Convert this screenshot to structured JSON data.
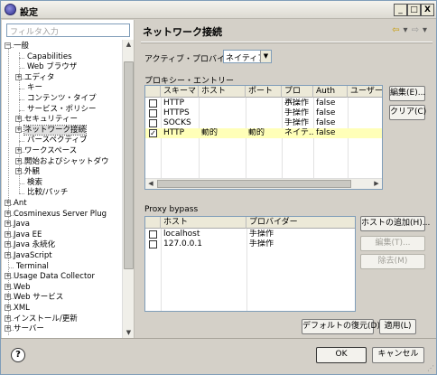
{
  "window": {
    "title": "設定",
    "controls": [
      "_",
      "□",
      "X"
    ]
  },
  "left": {
    "filter_placeholder": "フィルタ入力",
    "tree": [
      {
        "label": "一般",
        "expander": "−"
      },
      {
        "label": "Capabilities"
      },
      {
        "label": "Web ブラウザ"
      },
      {
        "label": "エディタ",
        "expander": "+"
      },
      {
        "label": "キー"
      },
      {
        "label": "コンテンツ・タイプ"
      },
      {
        "label": "サービス・ポリシー"
      },
      {
        "label": "セキュリティー",
        "expander": "+"
      },
      {
        "label": "ネットワーク接続",
        "expander": "+",
        "selected": true
      },
      {
        "label": "パースペクティブ"
      },
      {
        "label": "ワークスペース",
        "expander": "+"
      },
      {
        "label": "開始およびシャットダウ",
        "expander": "+"
      },
      {
        "label": "外観",
        "expander": "+"
      },
      {
        "label": "検索"
      },
      {
        "label": "比較/パッチ"
      },
      {
        "label": "Ant",
        "expander": "+"
      },
      {
        "label": "Cosminexus Server Plug",
        "expander": "+"
      },
      {
        "label": "Java",
        "expander": "+"
      },
      {
        "label": "Java EE",
        "expander": "+"
      },
      {
        "label": "Java 永続化",
        "expander": "+"
      },
      {
        "label": "JavaScript",
        "expander": "+"
      },
      {
        "label": "Terminal"
      },
      {
        "label": "Usage Data Collector",
        "expander": "+"
      },
      {
        "label": "Web",
        "expander": "+"
      },
      {
        "label": "Web サービス",
        "expander": "+"
      },
      {
        "label": "XML",
        "expander": "+"
      },
      {
        "label": "インストール/更新",
        "expander": "+"
      },
      {
        "label": "サーバー",
        "expander": "+"
      }
    ]
  },
  "main": {
    "title": "ネットワーク接続",
    "nav": {
      "back": "⇦",
      "forward": "⇨",
      "menu": "▾"
    },
    "active_provider": {
      "label": "アクティブ・プロバイダー:",
      "value": "ネイティブ"
    },
    "proxy_entries": {
      "label": "プロキシー・エントリー",
      "columns": [
        "",
        "スキーマ",
        "ホスト",
        "ポート",
        "プロバ...",
        "Auth",
        "ユーザー"
      ],
      "rows": [
        {
          "checked": false,
          "schema": "HTTP",
          "host": "",
          "port": "",
          "provider": "手操作",
          "auth": "false",
          "user": ""
        },
        {
          "checked": false,
          "schema": "HTTPS",
          "host": "",
          "port": "",
          "provider": "手操作",
          "auth": "false",
          "user": ""
        },
        {
          "checked": false,
          "schema": "SOCKS",
          "host": "",
          "port": "",
          "provider": "手操作",
          "auth": "false",
          "user": ""
        },
        {
          "checked": true,
          "schema": "HTTP",
          "host": "動的",
          "port": "動的",
          "provider": "ネイテ...",
          "auth": "false",
          "user": ""
        }
      ],
      "edit_button": "編集(E)...",
      "clear_button": "クリア(C)"
    },
    "proxy_bypass": {
      "label": "Proxy bypass",
      "columns": [
        "",
        "ホスト",
        "プロバイダー"
      ],
      "rows": [
        {
          "checked": false,
          "host": "localhost",
          "provider": "手操作"
        },
        {
          "checked": false,
          "host": "127.0.0.1",
          "provider": "手操作"
        }
      ],
      "add_button": "ホストの追加(H)...",
      "edit_button": "編集(T)...",
      "remove_button": "除去(M)"
    },
    "restore_button": "デフォルトの復元(D)",
    "apply_button": "適用(L)"
  },
  "footer": {
    "help": "?",
    "ok": "OK",
    "cancel": "キャンセル"
  }
}
